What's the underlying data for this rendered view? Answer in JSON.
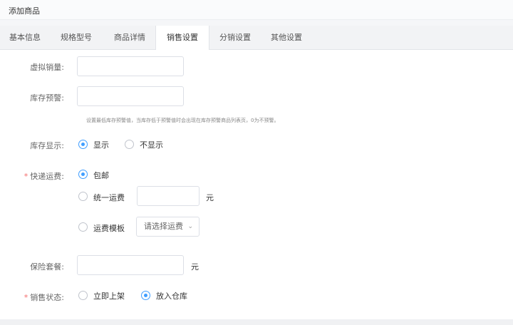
{
  "page": {
    "title": "添加商品"
  },
  "tabs": [
    {
      "label": "基本信息",
      "active": false
    },
    {
      "label": "规格型号",
      "active": false
    },
    {
      "label": "商品详情",
      "active": false
    },
    {
      "label": "销售设置",
      "active": true
    },
    {
      "label": "分销设置",
      "active": false
    },
    {
      "label": "其他设置",
      "active": false
    }
  ],
  "form": {
    "virtual_sales": {
      "label": "虚拟销量:",
      "value": ""
    },
    "stock_warning": {
      "label": "库存预警:",
      "value": "",
      "hint": "设置最低库存预警值，当库存低于预警值时会出现在库存预警商品列表页，0为不预警。"
    },
    "stock_display": {
      "label": "库存显示:",
      "options": [
        "显示",
        "不显示"
      ],
      "selected": "显示"
    },
    "shipping_fee": {
      "required": "*",
      "label": "快递运费:",
      "free_label": "包邮",
      "uniform_label": "统一运费",
      "uniform_value": "",
      "unit": "元",
      "template_label": "运费模板",
      "template_placeholder": "请选择运费",
      "selected": "包邮"
    },
    "insurance": {
      "label": "保险套餐:",
      "value": "",
      "unit": "元"
    },
    "sales_status": {
      "required": "*",
      "label": "销售状态:",
      "options": [
        "立即上架",
        "放入仓库"
      ],
      "selected": "放入仓库"
    }
  },
  "colors": {
    "accent": "#409eff",
    "required": "#f56c6c"
  }
}
